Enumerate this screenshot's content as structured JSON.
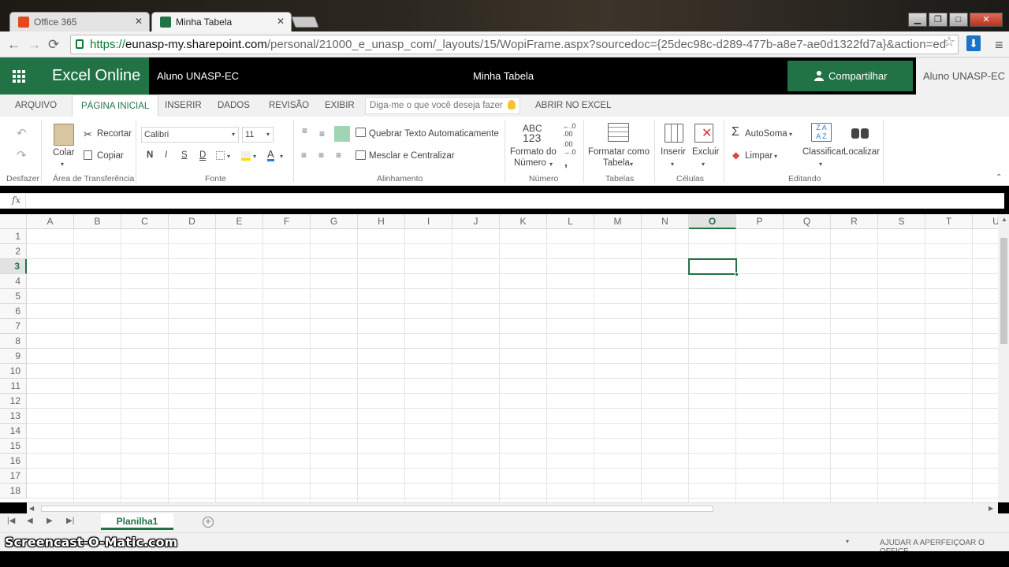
{
  "browser": {
    "tabs": [
      {
        "title": "Office 365",
        "icon": "office-icon"
      },
      {
        "title": "Minha Tabela",
        "icon": "excel-icon"
      }
    ],
    "url_proto": "https://",
    "url_host": "eunasp-my.sharepoint.com",
    "url_rest": "/personal/21000_e_unasp_com/_layouts/15/WopiFrame.aspx?sourcedoc={25dec98c-d289-477b-a8e7-ae0d1322fd7a}&action=ed"
  },
  "app": {
    "name": "Excel Online",
    "user": "Aluno UNASP-EC",
    "doc_title": "Minha Tabela",
    "share_label": "Compartilhar",
    "user_right": "Aluno UNASP-EC"
  },
  "ribbon_tabs": [
    "ARQUIVO",
    "PÁGINA INICIAL",
    "INSERIR",
    "DADOS",
    "REVISÃO",
    "EXIBIR"
  ],
  "tell_me": "Diga-me o que você deseja fazer",
  "open_in_excel": "ABRIR NO EXCEL",
  "ribbon": {
    "paste": "Colar",
    "cut": "Recortar",
    "copy": "Copiar",
    "font": "Calibri",
    "size": "11",
    "bold": "N",
    "italic": "I",
    "underline": "S",
    "dunderline": "D",
    "wrap": "Quebrar Texto Automaticamente",
    "merge": "Mesclar e Centralizar",
    "number_format_1": "Formato do",
    "number_format_2": "Número",
    "abc": "ABC",
    "n123": "123",
    "table_fmt_1": "Formatar como",
    "table_fmt_2": "Tabela",
    "insert": "Inserir",
    "delete": "Excluir",
    "autosum": "AutoSoma",
    "clear": "Limpar",
    "sort": "Classificar",
    "find": "Localizar",
    "groups": {
      "undo": "Desfazer",
      "clipboard": "Área de Transferência",
      "font": "Fonte",
      "alignment": "Alinhamento",
      "number": "Número",
      "tables": "Tabelas",
      "cells": "Células",
      "editing": "Editando"
    }
  },
  "formula_bar": {
    "fx": "fx",
    "value": ""
  },
  "grid": {
    "columns": [
      "A",
      "B",
      "C",
      "D",
      "E",
      "F",
      "G",
      "H",
      "I",
      "J",
      "K",
      "L",
      "M",
      "N",
      "O",
      "P",
      "Q",
      "R",
      "S",
      "T",
      "U"
    ],
    "rows": [
      "1",
      "2",
      "3",
      "4",
      "5",
      "6",
      "7",
      "8",
      "9",
      "10",
      "11",
      "12",
      "13",
      "14",
      "15",
      "16",
      "17",
      "18"
    ],
    "selected_column": "O",
    "selected_row": "3"
  },
  "sheets": [
    "Planilha1"
  ],
  "status": {
    "help": "AJUDAR A APERFEIÇOAR O OFFICE"
  },
  "watermark": "Screencast-O-Matic.com",
  "colors": {
    "excel_green": "#217346"
  }
}
